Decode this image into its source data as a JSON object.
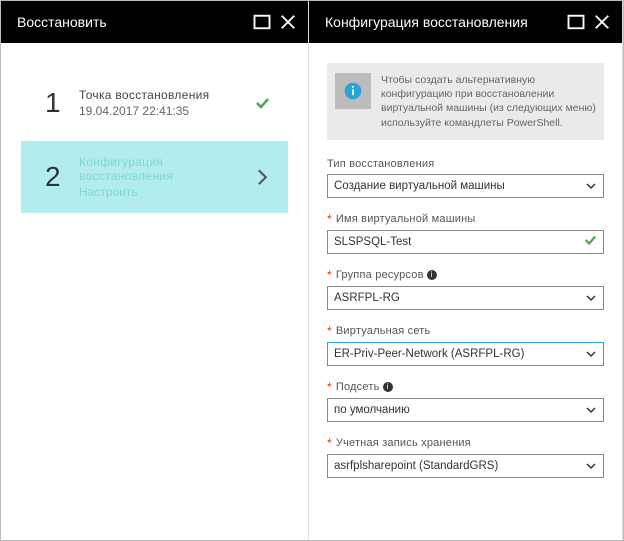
{
  "left_blade": {
    "title": "Восстановить",
    "step1": {
      "line1": "Точка восстановления",
      "line2": "19.04.2017 22:41:35"
    },
    "step2": {
      "line1": "Конфигурация восстановления",
      "line2": "Настроить"
    }
  },
  "right_blade": {
    "title": "Конфигурация восстановления",
    "info_text": "Чтобы создать альтернативную конфигурацию при восстановлении виртуальной машины (из следующих меню) используйте командлеты PowerShell.",
    "restore_type": {
      "label": "Тип восстановления",
      "value": "Создание виртуальной машины"
    },
    "vm_name": {
      "label": "Имя виртуальной машины",
      "value": "SLSPSQL-Test"
    },
    "resource_group": {
      "label": "Группа ресурсов",
      "value": "ASRFPL-RG"
    },
    "vnet": {
      "label": "Виртуальная сеть",
      "value": "ER-Priv-Peer-Network (ASRFPL-RG)"
    },
    "subnet": {
      "label": "Подсеть",
      "value": "по умолчанию"
    },
    "storage": {
      "label": "Учетная запись хранения",
      "value": "asrfplsharepoint (StandardGRS)"
    }
  }
}
